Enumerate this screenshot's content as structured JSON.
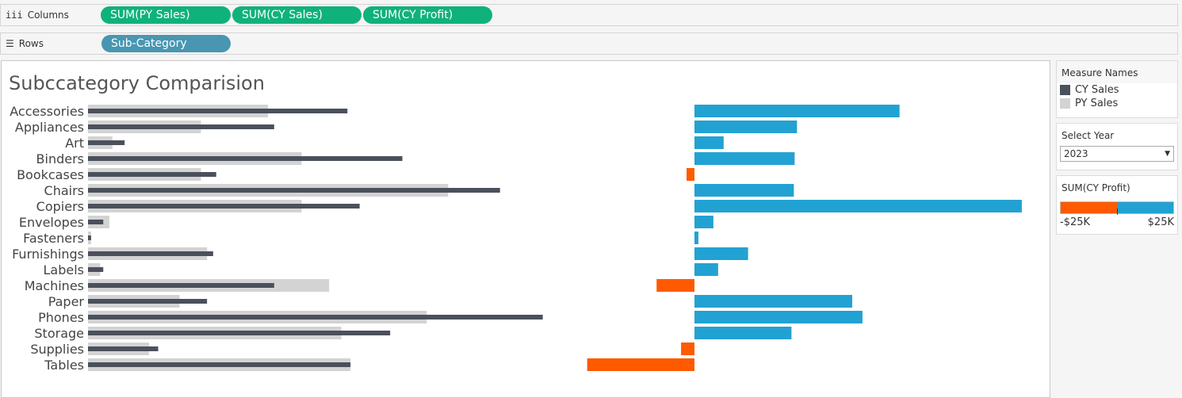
{
  "shelves": {
    "columns": {
      "label": "Columns",
      "icon": "iii",
      "pills": [
        "SUM(PY Sales)",
        "SUM(CY Sales)",
        "SUM(CY Profit)"
      ]
    },
    "rows": {
      "label": "Rows",
      "icon": "☰",
      "pills": [
        "Sub-Category"
      ]
    }
  },
  "colors": {
    "cy": "#4b515b",
    "py": "#d3d3d3",
    "profit_pos": "#22a2d3",
    "profit_neg": "#ff5a00",
    "pill_green": "#0fb27a",
    "pill_blue": "#4996b2"
  },
  "legend": {
    "title": "Measure Names",
    "items": [
      {
        "label": "CY Sales",
        "color": "#4b515b"
      },
      {
        "label": "PY Sales",
        "color": "#d3d3d3"
      }
    ]
  },
  "filter": {
    "title": "Select Year",
    "value": "2023"
  },
  "profit_scale": {
    "title": "SUM(CY Profit)",
    "min_label": "-$25K",
    "max_label": "$25K"
  },
  "chart_data": {
    "type": "bar",
    "title": "Subccategory Comparision",
    "categories": [
      "Accessories",
      "Appliances",
      "Art",
      "Binders",
      "Bookcases",
      "Chairs",
      "Copiers",
      "Envelopes",
      "Fasteners",
      "Furnishings",
      "Labels",
      "Machines",
      "Paper",
      "Phones",
      "Storage",
      "Supplies",
      "Tables"
    ],
    "series": [
      {
        "name": "PY Sales",
        "values": [
          59,
          37,
          8,
          70,
          37,
          118,
          70,
          7,
          1,
          39,
          4,
          79,
          30,
          111,
          83,
          20,
          86
        ]
      },
      {
        "name": "CY Sales",
        "values": [
          85,
          61,
          12,
          103,
          42,
          135,
          89,
          5,
          1,
          41,
          5,
          61,
          39,
          149,
          99,
          23,
          86
        ]
      },
      {
        "name": "CY Profit",
        "values": [
          26,
          13,
          3.7,
          12.7,
          -1,
          12.6,
          41.5,
          2.4,
          0.5,
          6.8,
          3,
          -4.8,
          20,
          21.3,
          12.3,
          -1.7,
          -13.6
        ]
      }
    ]
  }
}
